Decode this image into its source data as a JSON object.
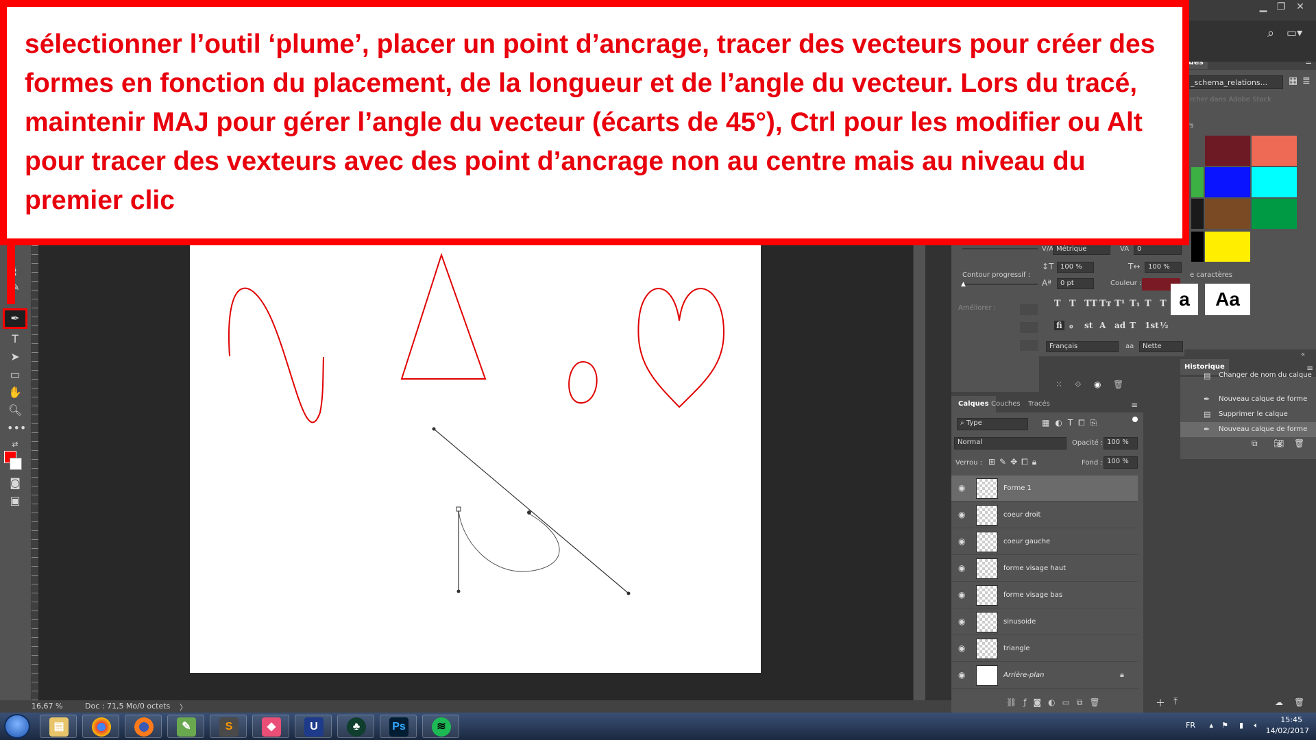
{
  "callout": {
    "text": "sélectionner l’outil ‘plume’, placer un point d’ancrage, tracer des vecteurs pour créer des formes en fonction du placement, de la longueur et de l’angle du vecteur. Lors du tracé, maintenir MAJ pour gérer l’angle du vecteur (écarts de 45°), Ctrl pour les modifier ou Alt pour tracer des vexteurs avec des point d’ancrage non au centre mais au niveau du premier clic"
  },
  "status": {
    "zoom": "16,67 %",
    "doc": "Doc : 71,5 Mo/0 octets"
  },
  "library": {
    "tab": "ues",
    "selected": "_schema_relations...",
    "search_placeholder": "rcher dans Adobe Stock",
    "colors_title": "rs",
    "chars_title": "e caractères",
    "aa1": "a",
    "aa2": "Aa",
    "colors": [
      "#6e1a24",
      "#ee6a55",
      "#3cb043",
      "#0a14ff",
      "#00ffff",
      "#1a1a1a",
      "#7a4a24",
      "#009a44",
      "#000000",
      "#ffee00"
    ]
  },
  "props": {
    "contour_label": "Contour progressif :",
    "ameliorer_label": "Améliorer :"
  },
  "character": {
    "kerning_label": "V/A",
    "kerning_value": "Métrique",
    "tracking_label": "VA",
    "tracking_value": "0",
    "vscale_value": "100 %",
    "hscale_value": "100 %",
    "baseline_value": "0 pt",
    "color_label": "Couleur :",
    "color_swatch": "#7a1a24",
    "styles": [
      "T",
      "T",
      "TT",
      "Tт",
      "T¹",
      "T₁",
      "T",
      "T"
    ],
    "opentype": [
      "fi",
      "ℴ",
      "st",
      "A",
      "ad",
      "T",
      "1st",
      "½"
    ],
    "language": "Français",
    "aa_label": "aa",
    "antialias": "Nette"
  },
  "layers": {
    "tabs": [
      "Calques",
      "Couches",
      "Tracés"
    ],
    "filter": "Type",
    "blend_mode": "Normal",
    "opacity_label": "Opacité :",
    "opacity_value": "100 %",
    "lock_label": "Verrou :",
    "fill_label": "Fond :",
    "fill_value": "100 %",
    "items": [
      {
        "name": "Forme 1"
      },
      {
        "name": "coeur droit"
      },
      {
        "name": "coeur gauche"
      },
      {
        "name": "forme visage haut"
      },
      {
        "name": "forme visage bas"
      },
      {
        "name": "sinusoide"
      },
      {
        "name": "triangle"
      },
      {
        "name": "Arrière-plan"
      }
    ]
  },
  "history": {
    "title": "Historique",
    "items": [
      {
        "label": "Changer de nom du calque"
      },
      {
        "label": "Nouveau calque de forme"
      },
      {
        "label": "Supprimer le calque"
      },
      {
        "label": "Nouveau calque de forme"
      }
    ]
  },
  "tray": {
    "lang": "FR",
    "time": "15:45",
    "date": "14/02/2017"
  },
  "colors": {
    "accent": "#ff0000",
    "shape_stroke": "#e00000",
    "path_stroke": "#333333"
  }
}
